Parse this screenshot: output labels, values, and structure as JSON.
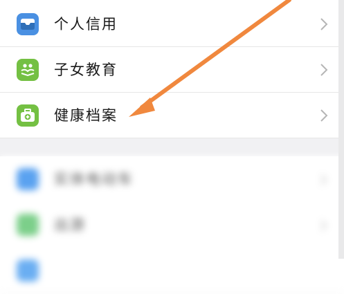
{
  "menu": {
    "items": [
      {
        "label": "个人信用",
        "icon": "envelope-tray-icon",
        "color": "#4a90e2"
      },
      {
        "label": "子女教育",
        "icon": "family-book-icon",
        "color": "#74c043"
      },
      {
        "label": "健康档案",
        "icon": "medical-kit-icon",
        "color": "#74c043"
      }
    ]
  },
  "blurred_section": {
    "items": [
      {
        "label": "实体电动车",
        "color": "#5aa2f0"
      },
      {
        "label": "出游",
        "color": "#7ccf8a"
      },
      {
        "label": "",
        "color": "#6aaef2"
      }
    ]
  },
  "annotation": {
    "arrow_color": "#f0883e"
  }
}
